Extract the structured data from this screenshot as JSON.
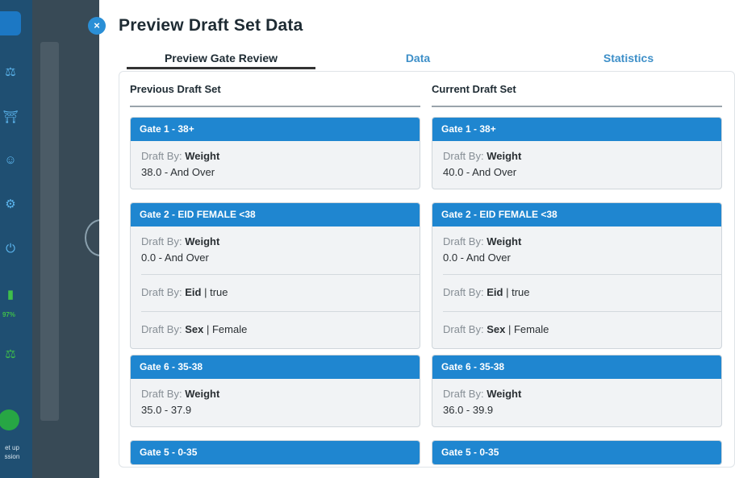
{
  "sidebar": {
    "battery_percent": "97%",
    "session_label_line1": "et up",
    "session_label_line2": "ssion"
  },
  "modal": {
    "close_glyph": "×",
    "title": "Preview Draft Set Data",
    "tabs": [
      {
        "label": "Preview Gate Review",
        "active": true
      },
      {
        "label": "Data",
        "active": false
      },
      {
        "label": "Statistics",
        "active": false
      }
    ]
  },
  "previous": {
    "header": "Previous Draft Set",
    "gates": [
      {
        "title": "Gate 1 - 38+",
        "rules": [
          {
            "label": "Draft By:",
            "type": "Weight",
            "range": "38.0 - And Over"
          }
        ]
      },
      {
        "title": "Gate 2 - EID FEMALE <38",
        "rules": [
          {
            "label": "Draft By:",
            "type": "Weight",
            "range": "0.0 - And Over"
          },
          {
            "label": "Draft By:",
            "type": "Eid",
            "sep": "|",
            "value": "true"
          },
          {
            "label": "Draft By:",
            "type": "Sex",
            "sep": "|",
            "value": "Female"
          }
        ]
      },
      {
        "title": "Gate 6 - 35-38",
        "rules": [
          {
            "label": "Draft By:",
            "type": "Weight",
            "range": "35.0 - 37.9"
          }
        ]
      },
      {
        "title": "Gate 5 - 0-35"
      }
    ]
  },
  "current": {
    "header": "Current Draft Set",
    "gates": [
      {
        "title": "Gate 1 - 38+",
        "rules": [
          {
            "label": "Draft By:",
            "type": "Weight",
            "range": "40.0 - And Over"
          }
        ]
      },
      {
        "title": "Gate 2 - EID FEMALE <38",
        "rules": [
          {
            "label": "Draft By:",
            "type": "Weight",
            "range": "0.0 - And Over"
          },
          {
            "label": "Draft By:",
            "type": "Eid",
            "sep": "|",
            "value": "true"
          },
          {
            "label": "Draft By:",
            "type": "Sex",
            "sep": "|",
            "value": "Female"
          }
        ]
      },
      {
        "title": "Gate 6 - 35-38",
        "rules": [
          {
            "label": "Draft By:",
            "type": "Weight",
            "range": "36.0 - 39.9"
          }
        ]
      },
      {
        "title": "Gate 5 - 0-35"
      }
    ]
  }
}
